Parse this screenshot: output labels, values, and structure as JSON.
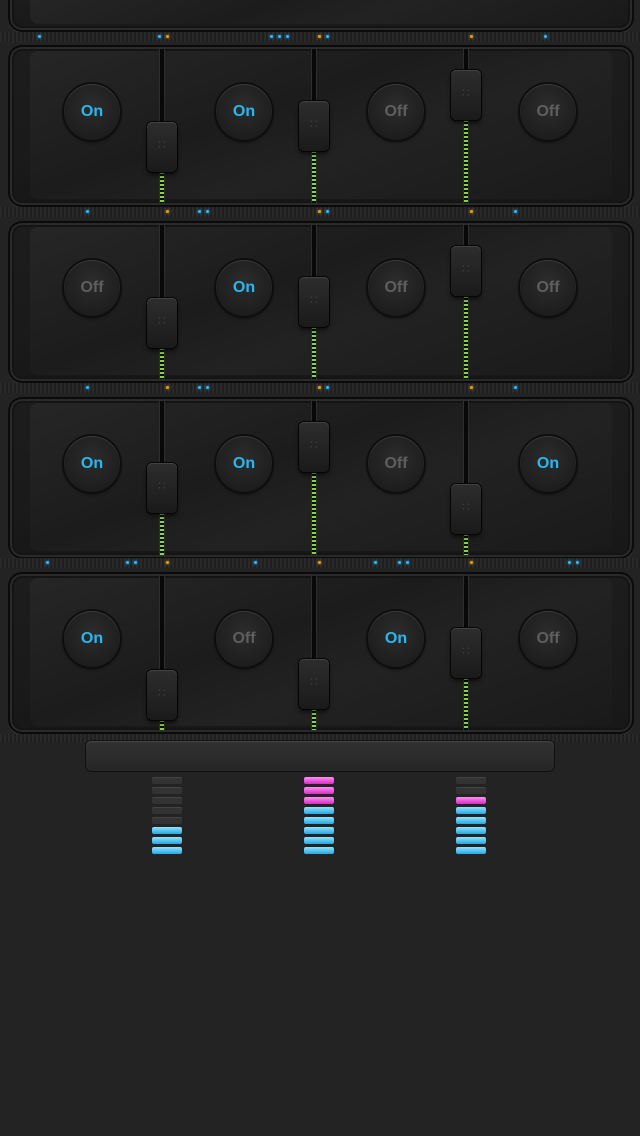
{
  "panels": [
    {
      "buttons": [
        "On",
        "On",
        "Off",
        "Off"
      ],
      "sliders": [
        0.3,
        0.5,
        0.8
      ]
    },
    {
      "buttons": [
        "Off",
        "On",
        "Off",
        "Off"
      ],
      "sliders": [
        0.3,
        0.5,
        0.8
      ]
    },
    {
      "buttons": [
        "On",
        "On",
        "Off",
        "On"
      ],
      "sliders": [
        0.4,
        0.8,
        0.2
      ]
    },
    {
      "buttons": [
        "On",
        "Off",
        "On",
        "Off"
      ],
      "sliders": [
        0.1,
        0.2,
        0.5
      ]
    }
  ],
  "meters": [
    {
      "lit": 3,
      "peak": 0
    },
    {
      "lit": 8,
      "peak": 3
    },
    {
      "lit": 6,
      "peak": 1
    }
  ],
  "colors": {
    "on": "#27b9f0",
    "off": "#5e5e5e",
    "led": "#7fd83a",
    "peak": "#d42ec8"
  }
}
